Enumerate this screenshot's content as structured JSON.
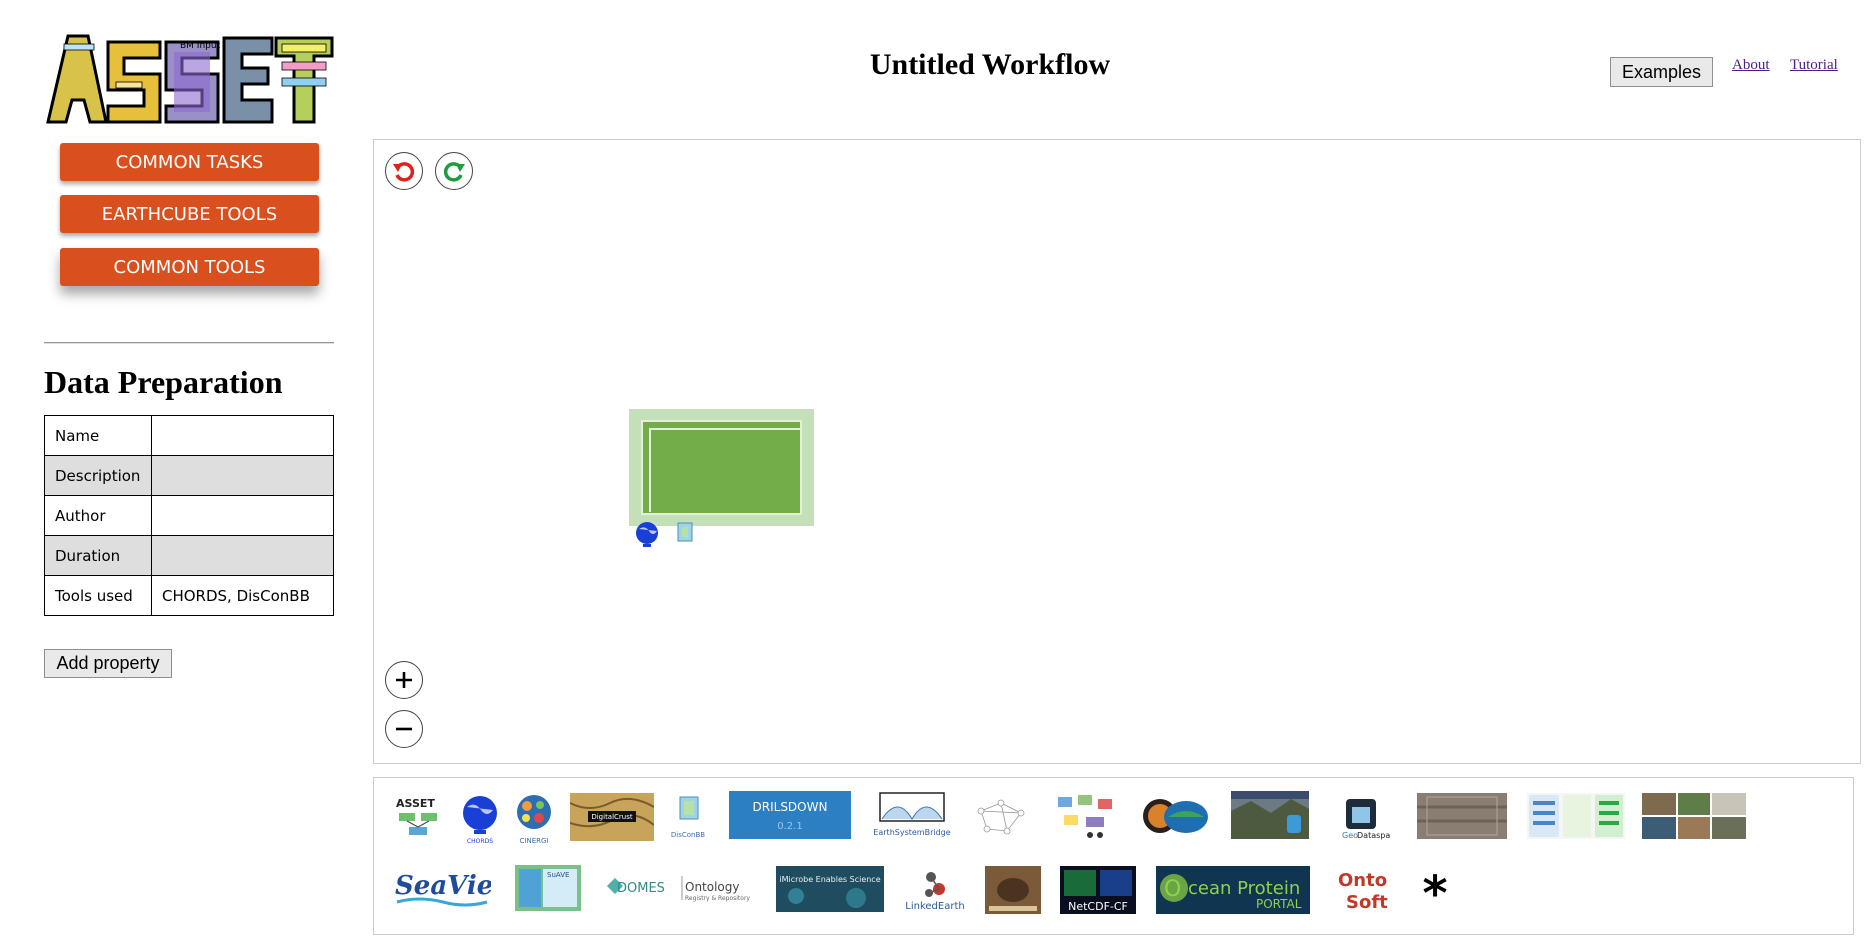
{
  "logo": {
    "text": "ASSET",
    "inner_label": "BM Input"
  },
  "workflow": {
    "title": "Untitled Workflow"
  },
  "topnav": {
    "examples_label": "Examples",
    "about_label": "About",
    "tutorial_label": "Tutorial"
  },
  "sidebar": {
    "buttons": [
      "COMMON TASKS",
      "EARTHCUBE TOOLS",
      "COMMON TOOLS"
    ],
    "section_title": "Data Preparation",
    "properties": [
      {
        "key": "Name",
        "value": ""
      },
      {
        "key": "Description",
        "value": ""
      },
      {
        "key": "Author",
        "value": ""
      },
      {
        "key": "Duration",
        "value": ""
      },
      {
        "key": "Tools used",
        "value": "CHORDS, DisConBB"
      }
    ],
    "add_property_label": "Add property"
  },
  "canvas": {
    "controls": {
      "undo_icon": "undo-icon",
      "redo_icon": "redo-icon",
      "zoom_in_icon": "plus-icon",
      "zoom_out_icon": "minus-icon"
    }
  },
  "tools": {
    "asset": "ASSET",
    "chords": "CHORDS",
    "cinergi": "CINERGI",
    "digitalcrust": "DigitalCrust",
    "disconbb": "DisConBB",
    "drilsdown": "DRILSDOWN",
    "drilsdown_version": "0.2.1",
    "esb": "EarthSystemBridge",
    "geodataspace_a": "Geo",
    "geodataspace_b": "Dataspace",
    "seaview": "SeaView",
    "suave": "SuAVE",
    "domes": "DOMES",
    "domes_ontology": "Ontology",
    "domes_sub": "Registry & Repository",
    "imicrobe": "iMicrobe Enables Science",
    "linkedearth": "LinkedEarth",
    "netcdf": "NetCDF-CF",
    "ocean_a": "O",
    "ocean_b": "cean Protein",
    "ocean_c": "PORTAL",
    "onto_a": "Onto",
    "onto_b": "Soft",
    "star": "*"
  },
  "colors": {
    "accent": "#d94f1e",
    "node_fill": "#72ad49",
    "node_halo": "#c4e0b8"
  }
}
